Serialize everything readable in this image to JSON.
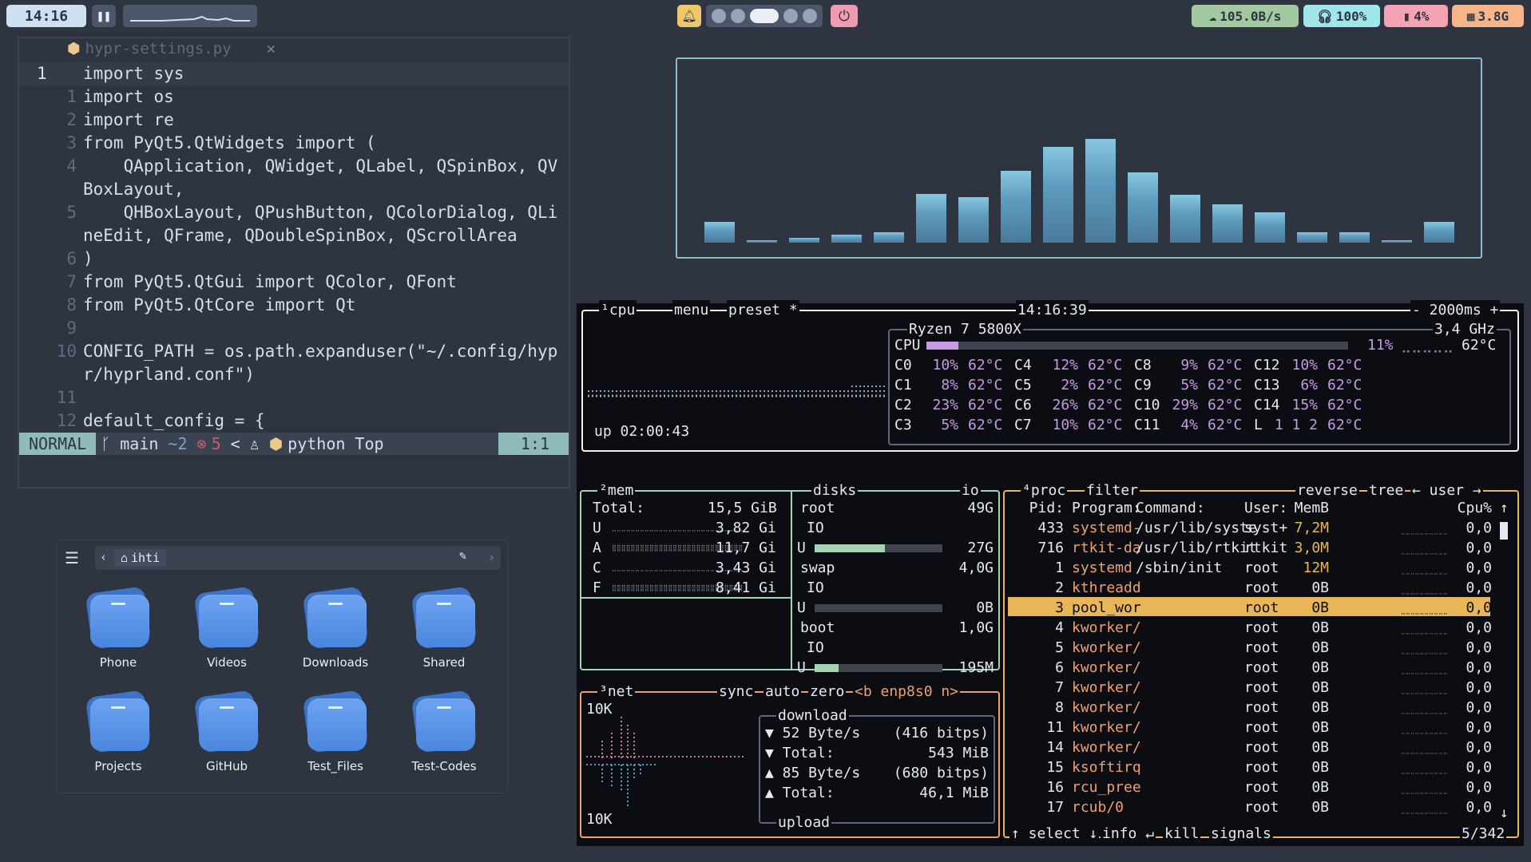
{
  "topbar": {
    "clock": "14:16",
    "pause_icon": "pause-icon",
    "notification_icon": "bell-icon",
    "power_icon": "power-icon",
    "network": "105.0B/s",
    "headset": "100%",
    "battery": "4%",
    "memory": "3.8G",
    "workspaces": 5
  },
  "editor": {
    "tab_name": "hypr-settings.py",
    "lines": [
      {
        "num": "1",
        "text": "import sys"
      },
      {
        "num": "1",
        "text": "import os"
      },
      {
        "num": "2",
        "text": "import re"
      },
      {
        "num": "3",
        "text": "from PyQt5.QtWidgets import ("
      },
      {
        "num": "4",
        "text": "    QApplication, QWidget, QLabel, QSpinBox, QV"
      },
      {
        "num": "",
        "text": "BoxLayout,"
      },
      {
        "num": "5",
        "text": "    QHBoxLayout, QPushButton, QColorDialog, QLi"
      },
      {
        "num": "",
        "text": "neEdit, QFrame, QDoubleSpinBox, QScrollArea"
      },
      {
        "num": "6",
        "text": ")"
      },
      {
        "num": "7",
        "text": "from PyQt5.QtGui import QColor, QFont"
      },
      {
        "num": "8",
        "text": "from PyQt5.QtCore import Qt"
      },
      {
        "num": "9",
        "text": ""
      },
      {
        "num": "10",
        "text": "CONFIG_PATH = os.path.expanduser(\"~/.config/hyp"
      },
      {
        "num": "",
        "text": "r/hyprland.conf\")"
      },
      {
        "num": "11",
        "text": ""
      },
      {
        "num": "12",
        "text": "default_config = {"
      }
    ],
    "status": {
      "mode": "NORMAL",
      "branch": "main",
      "changes": "~2",
      "errors": "5",
      "lt": "<",
      "filetype": "python",
      "scroll": "Top",
      "position": "1:1"
    }
  },
  "cava": {
    "levels": [
      0.2,
      0.02,
      0.05,
      0.08,
      0.1,
      0.47,
      0.44,
      0.69,
      0.92,
      1.0,
      0.68,
      0.46,
      0.37,
      0.29,
      0.1,
      0.1,
      0.02,
      0.2
    ]
  },
  "file_manager": {
    "location": "ihti",
    "folders": [
      "Phone",
      "Videos",
      "Downloads",
      "Shared",
      "Projects",
      "GitHub",
      "Test_Files",
      "Test-Codes"
    ]
  },
  "btop": {
    "cpu": {
      "tabs": [
        "¹cpu",
        "menu",
        "preset *"
      ],
      "time": "14:16:39",
      "interval": "- 2000ms +",
      "model": "Ryzen 7 5800X",
      "freq": "3,4 GHz",
      "total_label": "CPU",
      "total_pct": "11%",
      "total_temp": "62°C",
      "total_load": 0.11,
      "uptime": "up 02:00:43",
      "cores": [
        [
          "C0",
          "10%",
          "62°C"
        ],
        [
          "C4",
          "12%",
          "62°C"
        ],
        [
          "C8",
          "9%",
          "62°C"
        ],
        [
          "C12",
          "10%",
          "62°C"
        ],
        [
          "C1",
          "8%",
          "62°C"
        ],
        [
          "C5",
          "2%",
          "62°C"
        ],
        [
          "C9",
          "5%",
          "62°C"
        ],
        [
          "C13",
          "6%",
          "62°C"
        ],
        [
          "C2",
          "23%",
          "62°C"
        ],
        [
          "C6",
          "26%",
          "62°C"
        ],
        [
          "C10",
          "29%",
          "62°C"
        ],
        [
          "C14",
          "15%",
          "62°C"
        ],
        [
          "C3",
          "5%",
          "62°C"
        ],
        [
          "C7",
          "10%",
          "62°C"
        ],
        [
          "C11",
          "4%",
          "62°C"
        ],
        [
          "L",
          "1 1 2",
          "62°C"
        ]
      ]
    },
    "mem": {
      "title": "²mem",
      "total_label": "Total:",
      "total": "15,5 GiB",
      "rows": [
        [
          "U",
          "3,82 Gi"
        ],
        [
          "A",
          "11,7 Gi"
        ],
        [
          "C",
          "3,43 Gi"
        ],
        [
          "F",
          "8,41 Gi"
        ]
      ]
    },
    "disks": {
      "title": "disks",
      "io_label": "io",
      "entries": [
        {
          "name": "root",
          "size": "49G",
          "used": "27G",
          "fill": 0.55
        },
        {
          "name": "swap",
          "size": "4,0G",
          "used": "0B",
          "fill": 0.0
        },
        {
          "name": "boot",
          "size": "1,0G",
          "used": "195M",
          "fill": 0.19
        }
      ]
    },
    "net": {
      "title": "³net",
      "buttons": [
        "sync",
        "auto",
        "zero",
        "<b enp8s0 n>"
      ],
      "scale_top": "10K",
      "scale_bottom": "10K",
      "download_label": "download",
      "upload_label": "upload",
      "rows": [
        [
          "▼ 52 Byte/s",
          "(416 bitps)"
        ],
        [
          "▼ Total:",
          "543 MiB"
        ],
        [
          "▲ 85 Byte/s",
          "(680 bitps)"
        ],
        [
          "▲ Total:",
          "46,1 MiB"
        ]
      ]
    },
    "proc": {
      "title": "⁴proc",
      "buttons": [
        "filter",
        "reverse",
        "tree",
        "← user →"
      ],
      "headers": [
        "Pid:",
        "Program:",
        "Command:",
        "User:",
        "MemB",
        "Cpu%"
      ],
      "rows": [
        [
          "433",
          "systemd-",
          "/usr/lib/syste",
          "syst+",
          "7,2M",
          "0,0"
        ],
        [
          "716",
          "rtkit-da",
          "/usr/lib/rtkit",
          "rtkit",
          "3,0M",
          "0,0"
        ],
        [
          "1",
          "systemd",
          "/sbin/init",
          "root",
          "12M",
          "0,0"
        ],
        [
          "2",
          "kthreadd",
          "",
          "root",
          "0B",
          "0,0"
        ],
        [
          "3",
          "pool_wor",
          "",
          "root",
          "0B",
          "0,0"
        ],
        [
          "4",
          "kworker/",
          "",
          "root",
          "0B",
          "0,0"
        ],
        [
          "5",
          "kworker/",
          "",
          "root",
          "0B",
          "0,0"
        ],
        [
          "6",
          "kworker/",
          "",
          "root",
          "0B",
          "0,0"
        ],
        [
          "7",
          "kworker/",
          "",
          "root",
          "0B",
          "0,0"
        ],
        [
          "8",
          "kworker/",
          "",
          "root",
          "0B",
          "0,0"
        ],
        [
          "11",
          "kworker/",
          "",
          "root",
          "0B",
          "0,0"
        ],
        [
          "14",
          "kworker/",
          "",
          "root",
          "0B",
          "0,0"
        ],
        [
          "15",
          "ksoftirq",
          "",
          "root",
          "0B",
          "0,0"
        ],
        [
          "16",
          "rcu_pree",
          "",
          "root",
          "0B",
          "0,0"
        ],
        [
          "17",
          "rcub/0",
          "",
          "root",
          "0B",
          "0,0"
        ]
      ],
      "selected_index": 4,
      "footer": [
        "↑ select ↓",
        "info ↵",
        "kill",
        "signals"
      ],
      "count": "5/342"
    }
  }
}
